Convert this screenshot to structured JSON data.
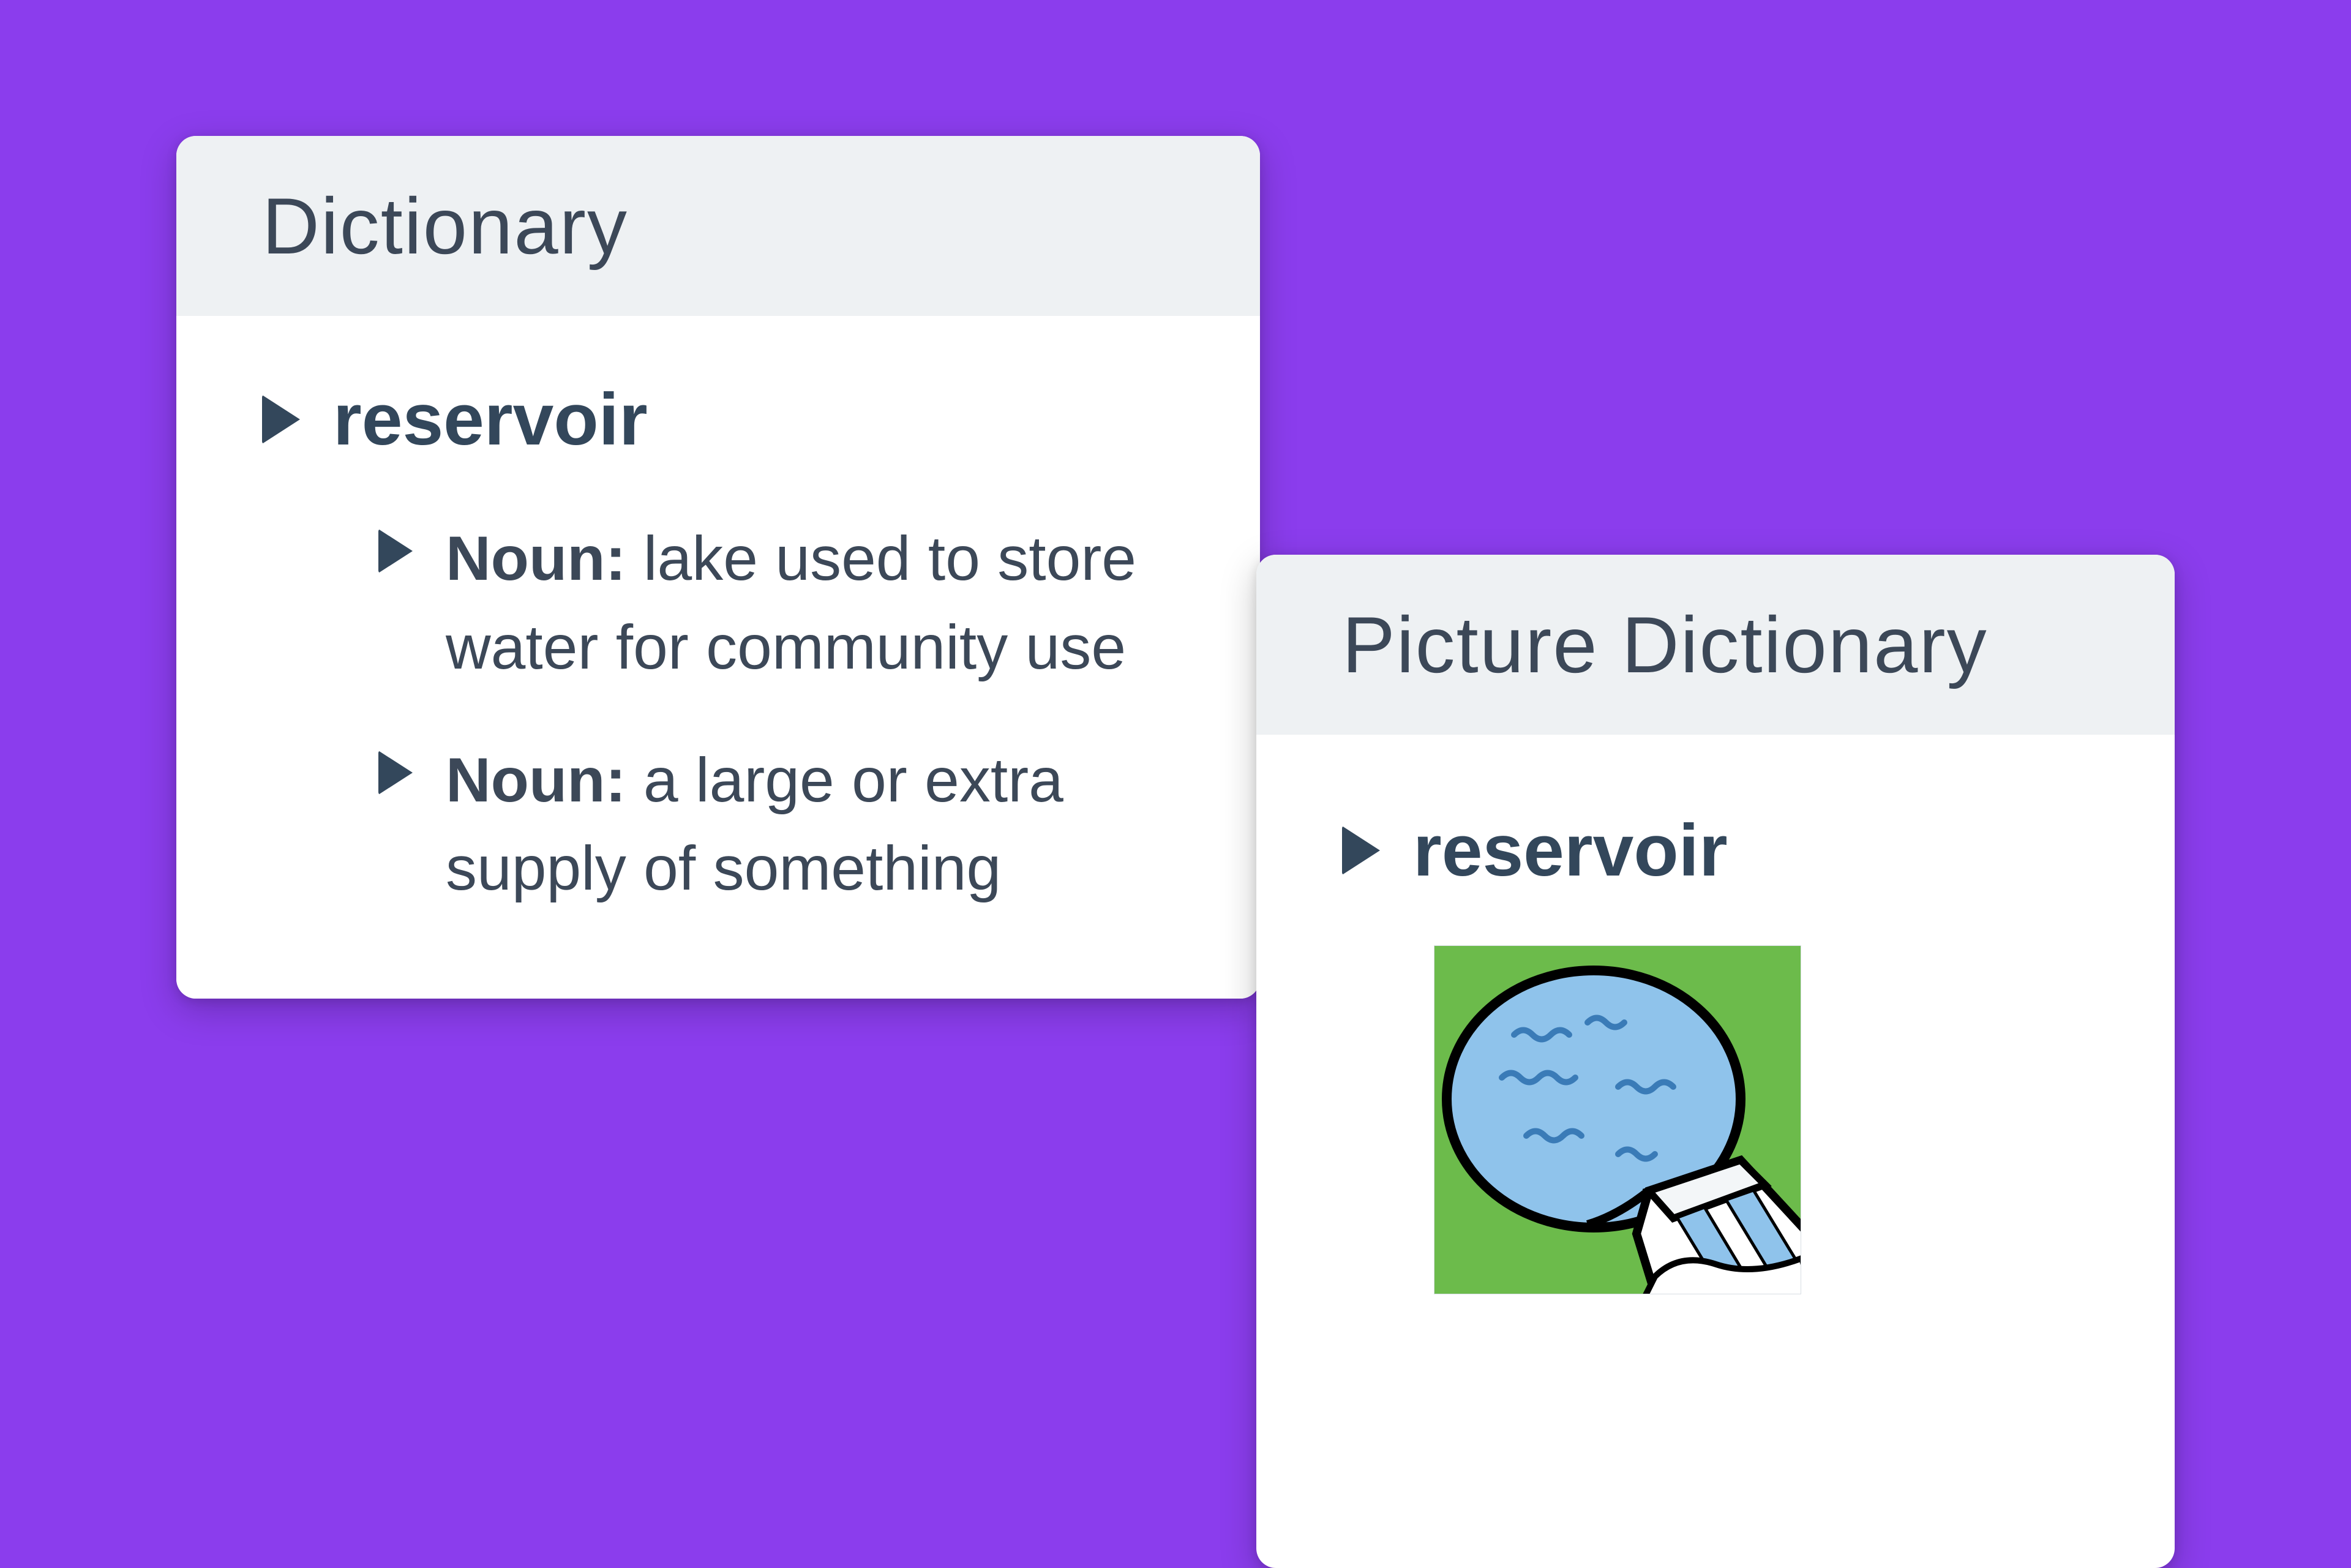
{
  "dictionary_card": {
    "title": "Dictionary",
    "word": "reservoir",
    "definitions": [
      {
        "pos": "Noun:",
        "text": " lake used to store water for community use"
      },
      {
        "pos": "Noun:",
        "text": " a large or extra supply of something"
      }
    ]
  },
  "picture_card": {
    "title": "Picture Dictionary",
    "word": "reservoir",
    "image_alt": "reservoir-dam-illustration"
  }
}
